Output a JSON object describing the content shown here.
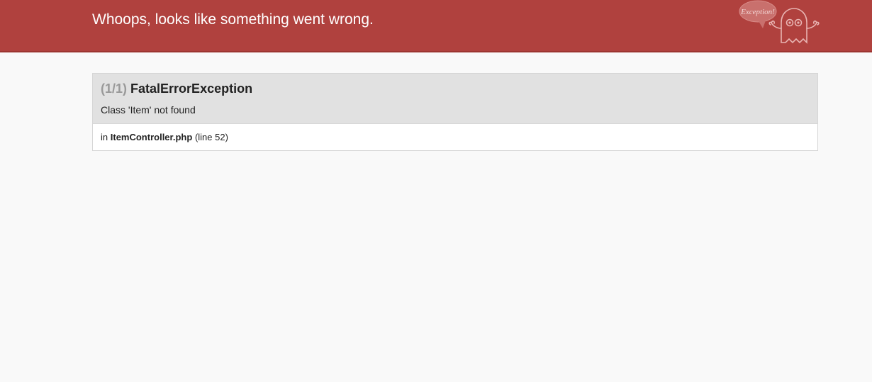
{
  "header": {
    "title": "Whoops, looks like something went wrong.",
    "logo_text": "Exception!",
    "logo_icon": "ghost-icon",
    "background_color": "#b0413e"
  },
  "exception": {
    "count": "(1/1)",
    "class_name": "FatalErrorException",
    "message": "Class 'Item' not found",
    "location_prefix": "in",
    "file": "ItemController.php",
    "line": "(line 52)"
  }
}
